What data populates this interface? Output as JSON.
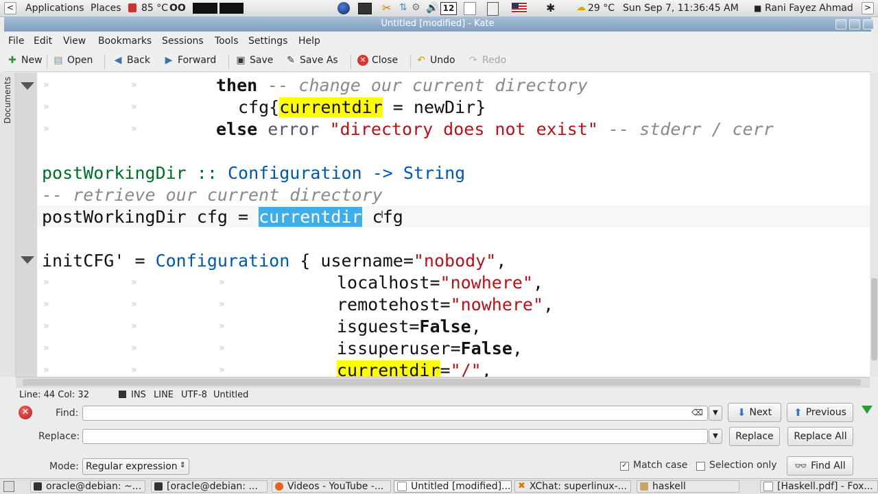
{
  "top_panel": {
    "applications": "Applications",
    "places": "Places",
    "cpu_temp": "85 °C",
    "weather": "29 °C",
    "clock": "Sun Sep  7, 11:36:45 AM",
    "user": "Rani Fayez Ahmad",
    "workspace": "12"
  },
  "window": {
    "title": "Untitled [modified] - Kate"
  },
  "menubar": [
    "File",
    "Edit",
    "View",
    "Bookmarks",
    "Sessions",
    "Tools",
    "Settings",
    "Help"
  ],
  "toolbar": {
    "new": "New",
    "open": "Open",
    "back": "Back",
    "forward": "Forward",
    "save": "Save",
    "save_as": "Save As",
    "close": "Close",
    "undo": "Undo",
    "redo": "Redo"
  },
  "sidebar": {
    "documents_tab": "Documents"
  },
  "editor": {
    "lines": [
      "then -- change our current directory",
      "cfg{currentdir = newDir}",
      "else error \"directory does not exist\" -- stderr / cerr",
      "",
      "postWorkingDir :: Configuration -> String",
      "-- retrieve our current directory",
      "postWorkingDir cfg = currentdir cfg",
      "",
      "initCFG' = Configuration { username=\"nobody\",",
      "localhost=\"nowhere\",",
      "remotehost=\"nowhere\",",
      "isguest=False,",
      "issuperuser=False,",
      "currentdir=\"/\","
    ],
    "tab_marker": "»"
  },
  "status": {
    "position": "Line: 44 Col: 32",
    "mode": "INS",
    "wrap": "LINE",
    "encoding": "UTF-8",
    "filename": "Untitled"
  },
  "search": {
    "find_label": "Find:",
    "find_value": "",
    "replace_label": "Replace:",
    "replace_value": "",
    "mode_label": "Mode:",
    "mode_value": "Regular expression",
    "next": "Next",
    "previous": "Previous",
    "replace_btn": "Replace",
    "replace_all": "Replace All",
    "match_case": "Match case",
    "match_case_checked": true,
    "selection_only": "Selection only",
    "selection_only_checked": false,
    "find_all": "Find All"
  },
  "taskbar": [
    {
      "label": "oracle@debian: ~...",
      "active": false
    },
    {
      "label": "[oracle@debian: ...",
      "active": false
    },
    {
      "label": "Videos - YouTube -...",
      "active": false
    },
    {
      "label": "Untitled [modified]...",
      "active": true
    },
    {
      "label": "XChat: superlinux-...",
      "active": false
    },
    {
      "label": "haskell",
      "active": false
    },
    {
      "label": "[Haskell.pdf] - Fox...",
      "active": false
    }
  ],
  "colors": {
    "keyword": "#111111",
    "comment": "#898989",
    "string": "#b5121b",
    "type": "#0057ae",
    "function_decl": "#006e28",
    "search_highlight": "#ffff00",
    "selection": "#3daee9",
    "titlebar": "#8aa7c4"
  }
}
